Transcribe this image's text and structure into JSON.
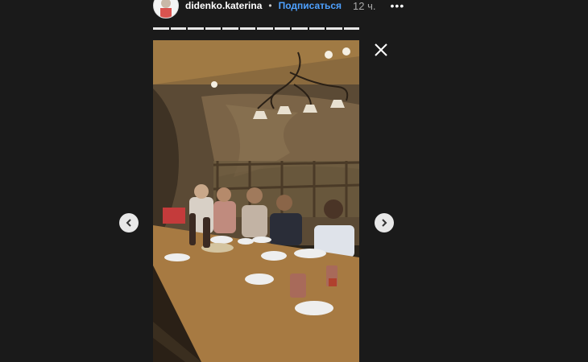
{
  "header": {
    "username": "didenko.katerina",
    "separator": "•",
    "follow_label": "Подписаться",
    "time": "12 ч.",
    "more_label": "•••"
  },
  "story": {
    "segments": 12,
    "content_icon": "story-photo"
  },
  "controls": {
    "close_icon": "close-icon",
    "prev_icon": "chevron-left-icon",
    "next_icon": "chevron-right-icon"
  },
  "colors": {
    "background": "#1a1a1a",
    "follow": "#4ea1ff",
    "progress": "#e8e8e8"
  }
}
